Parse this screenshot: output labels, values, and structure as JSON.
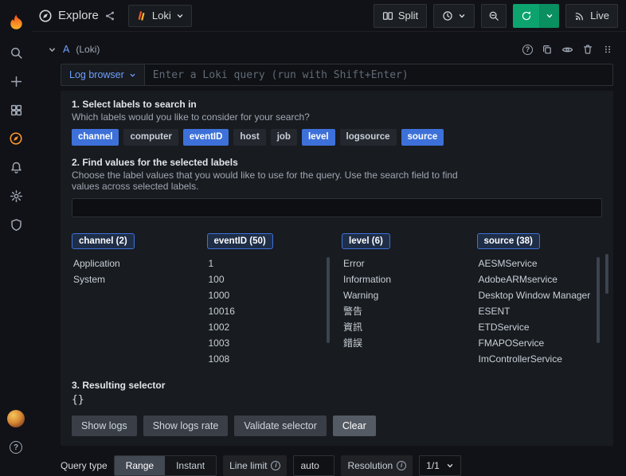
{
  "theme": {
    "accent_blue": "#3d71d9",
    "link_blue": "#6e9fff",
    "refresh_green": "#0ca36f",
    "brand_orange": "#ff9830",
    "panel_bg": "#181b1f",
    "page_bg": "#111217"
  },
  "icons": [
    "grafana-logo",
    "search-icon",
    "plus-icon",
    "dashboards-icon",
    "compass-icon",
    "bell-icon",
    "gear-icon",
    "shield-icon",
    "avatar",
    "help-circle-icon",
    "share-icon",
    "loki-logo",
    "chevron-down-icon",
    "split-icon",
    "clock-icon",
    "zoom-out-icon",
    "sync-icon",
    "live-icon",
    "copy-icon",
    "eye-icon",
    "trash-icon",
    "drag-handle-icon",
    "info-icon"
  ],
  "topbar": {
    "title": "Explore",
    "datasource": "Loki",
    "split_label": "Split",
    "live_label": "Live"
  },
  "query_row": {
    "ref_id": "A",
    "datasource_hint": "(Loki)"
  },
  "query_editor": {
    "log_browser_label": "Log browser",
    "placeholder": "Enter a Loki query (run with Shift+Enter)"
  },
  "log_browser": {
    "step1_title": "1. Select labels to search in",
    "step1_subtitle": "Which labels would you like to consider for your search?",
    "labels": [
      {
        "label": "channel",
        "selected": true
      },
      {
        "label": "computer",
        "selected": false
      },
      {
        "label": "eventID",
        "selected": true
      },
      {
        "label": "host",
        "selected": false
      },
      {
        "label": "job",
        "selected": false
      },
      {
        "label": "level",
        "selected": true
      },
      {
        "label": "logsource",
        "selected": false
      },
      {
        "label": "source",
        "selected": true
      }
    ],
    "step2_title": "2. Find values for the selected labels",
    "step2_subtitle": "Choose the label values that you would like to use for the query. Use the search field to find values across selected labels.",
    "search_value": "",
    "columns": [
      {
        "header": "channel (2)",
        "values": [
          "Application",
          "System"
        ]
      },
      {
        "header": "eventID (50)",
        "values": [
          "1",
          "100",
          "1000",
          "10016",
          "1002",
          "1003",
          "1008"
        ]
      },
      {
        "header": "level (6)",
        "values": [
          "Error",
          "Information",
          "Warning",
          "警告",
          "資訊",
          "錯誤"
        ]
      },
      {
        "header": "source (38)",
        "values": [
          "AESMService",
          "AdobeARMservice",
          "Desktop Window Manager",
          "ESENT",
          "ETDService",
          "FMAPOService",
          "ImControllerService"
        ]
      }
    ],
    "step3_title": "3. Resulting selector",
    "selector": "{}",
    "buttons": {
      "show_logs": "Show logs",
      "show_logs_rate": "Show logs rate",
      "validate_selector": "Validate selector",
      "clear": "Clear"
    }
  },
  "bottom_toolbar": {
    "query_type_label": "Query type",
    "range_label": "Range",
    "instant_label": "Instant",
    "line_limit_label": "Line limit",
    "line_limit_value": "auto",
    "resolution_label": "Resolution",
    "resolution_value": "1/1"
  }
}
